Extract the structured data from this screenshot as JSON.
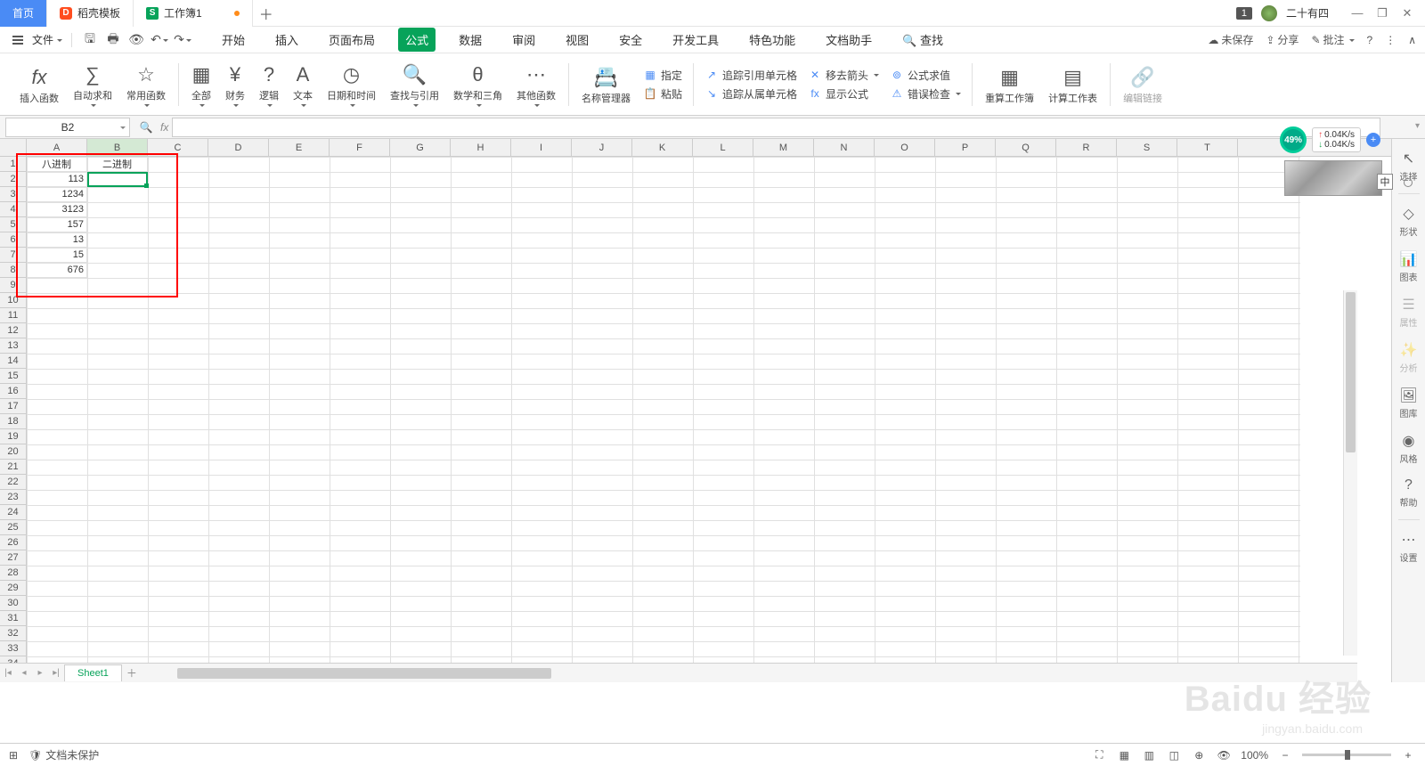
{
  "titlebar": {
    "tabs": {
      "home": "首页",
      "doke": "稻壳模板",
      "work": "工作簿1"
    },
    "page_indicator": "1",
    "username": "二十有四",
    "cn_indicator": "中"
  },
  "menubar": {
    "file": "文件",
    "tabs": [
      "开始",
      "插入",
      "页面布局",
      "公式",
      "数据",
      "审阅",
      "视图",
      "安全",
      "开发工具",
      "特色功能",
      "文档助手"
    ],
    "active_tab": "公式",
    "search": "查找",
    "unsaved": "未保存",
    "share": "分享",
    "approve": "批注"
  },
  "ribbon": {
    "insert_fn": "插入函数",
    "auto_sum": "自动求和",
    "common": "常用函数",
    "all": "全部",
    "finance": "财务",
    "logic": "逻辑",
    "text": "文本",
    "datetime": "日期和时间",
    "lookup": "查找与引用",
    "math": "数学和三角",
    "other": "其他函数",
    "name_mgr": "名称管理器",
    "paste": "粘贴",
    "assign": "指定",
    "trace_prec": "追踪引用单元格",
    "trace_dep": "追踪从属单元格",
    "remove_arrow": "移去箭头",
    "show_formula": "显示公式",
    "eval": "公式求值",
    "err_check": "错误检查",
    "recalc_book": "重算工作簿",
    "recalc_sheet": "计算工作表",
    "edit_link": "编辑链接"
  },
  "namebox": "B2",
  "columns": [
    "A",
    "B",
    "C",
    "D",
    "E",
    "F",
    "G",
    "H",
    "I",
    "J",
    "K",
    "L",
    "M",
    "N",
    "O",
    "P",
    "Q",
    "R",
    "S",
    "T"
  ],
  "headers": {
    "A1": "八进制",
    "B1": "二进制"
  },
  "data": {
    "A2": "113",
    "A3": "1234",
    "A4": "3123",
    "A5": "157",
    "A6": "13",
    "A7": "15",
    "A8": "676"
  },
  "float": {
    "pct": "49%",
    "up": "0.04K/s",
    "dn": "0.04K/s"
  },
  "sidebar": {
    "select": "选择",
    "shape": "形状",
    "chart": "图表",
    "attr": "属性",
    "analyze": "分析",
    "gallery": "图库",
    "style": "风格",
    "help": "帮助",
    "settings": "设置"
  },
  "sheet": {
    "name": "Sheet1"
  },
  "status": {
    "protect": "文档未保护",
    "zoom": "100%"
  },
  "watermark": {
    "main": "Baidu 经验",
    "sub": "jingyan.baidu.com"
  }
}
